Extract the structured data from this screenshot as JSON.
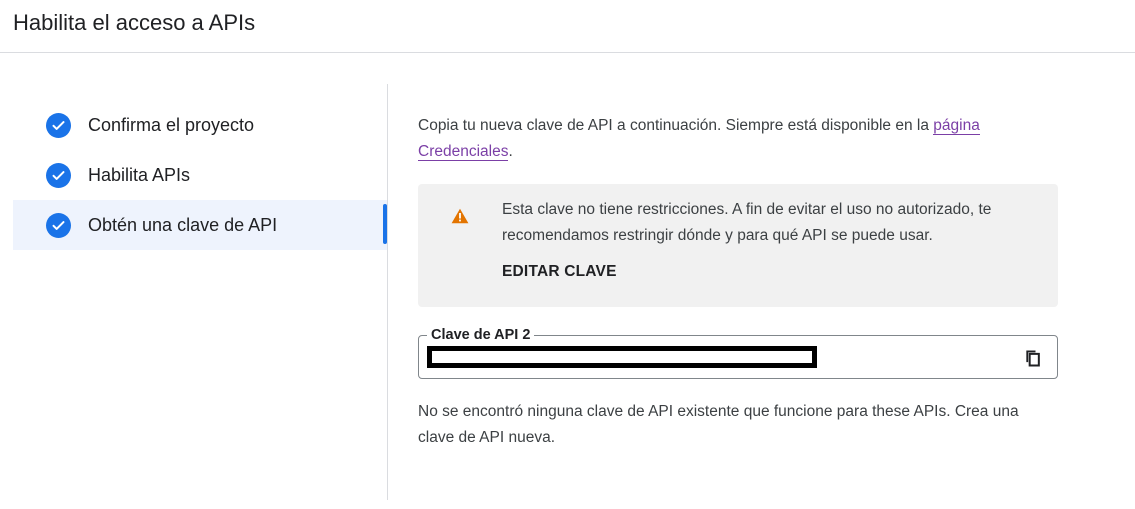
{
  "header": {
    "title": "Habilita el acceso a APIs"
  },
  "stepper": {
    "steps": [
      {
        "label": "Confirma el proyecto",
        "icon": "check-circle-icon"
      },
      {
        "label": "Habilita APIs",
        "icon": "check-circle-icon"
      },
      {
        "label": "Obtén una clave de API",
        "icon": "check-circle-icon",
        "active": true
      }
    ]
  },
  "content": {
    "intro_text": "Copia tu nueva clave de API a continuación. Siempre está disponible en la ",
    "intro_link": "página Credenciales",
    "intro_end": ".",
    "warning": {
      "icon": "warning-icon",
      "text": "Esta clave no tiene restricciones. A fin de evitar el uso no autorizado, te recomendamos restringir dónde y para qué API se puede usar.",
      "button": "EDITAR CLAVE"
    },
    "key_field": {
      "label": "Clave de API 2",
      "copy_icon": "copy-icon"
    },
    "footer_text": "No se encontró ninguna clave de API existente que funcione para these APIs. Crea una clave de API nueva."
  },
  "colors": {
    "accent": "#1a73e8",
    "link": "#7b3fa6",
    "warning": "#e37400"
  }
}
